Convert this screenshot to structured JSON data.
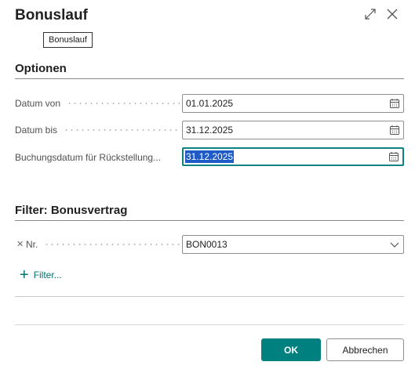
{
  "dialog": {
    "title": "Bonuslauf",
    "tooltip": "Bonuslauf"
  },
  "options": {
    "heading": "Optionen",
    "fields": [
      {
        "label": "Datum von",
        "value": "01.01.2025"
      },
      {
        "label": "Datum bis",
        "value": "31.12.2025"
      },
      {
        "label": "Buchungsdatum für Rückstellung...",
        "value": "31.12.2025"
      }
    ]
  },
  "filter": {
    "heading": "Filter: Bonusvertrag",
    "remove_glyph": "✕",
    "field_label": "Nr.",
    "field_value": "BON0013",
    "add_label": "Filter..."
  },
  "buttons": {
    "ok": "OK",
    "cancel": "Abbrechen"
  },
  "colors": {
    "accent": "#00807f",
    "selection": "#1e5bc6"
  },
  "icons": [
    "expand-icon",
    "close-icon",
    "calendar-icon",
    "chevron-down-icon",
    "plus-icon",
    "remove-filter-icon"
  ]
}
